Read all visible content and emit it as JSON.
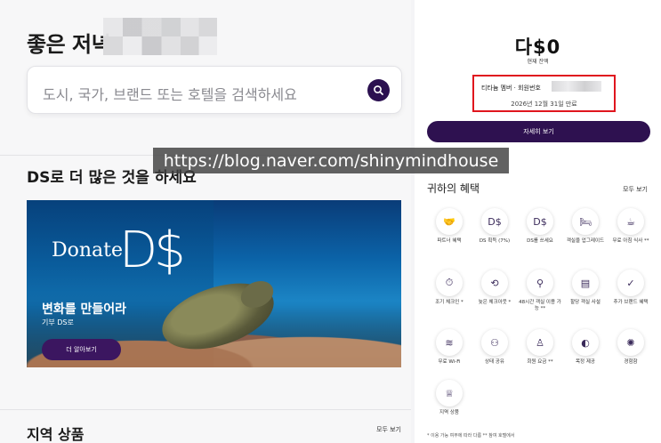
{
  "greeting": "좋은 저녁",
  "search": {
    "placeholder": "도시, 국가, 브랜드 또는 호텔을 검색하세요"
  },
  "section_title": "DS로 더 많은 것을 하세요",
  "banner": {
    "logo_donate": "Donate",
    "logo_ds": "D$",
    "title": "변화를 만들어라",
    "subtitle": "기부 DS로",
    "button": "더 알아보기"
  },
  "region": {
    "title": "지역 상품",
    "all": "모두 보기"
  },
  "account": {
    "brand": "다$0",
    "balance_label": "현재 잔액",
    "member": "티타늄 멤버 · 회원번호",
    "expiry": "2026년 12월 31일 만료",
    "detail_button": "자세히 보기"
  },
  "benefits": {
    "title": "귀하의 혜택",
    "all": "모두 보기",
    "items": [
      {
        "icon": "handshake-icon",
        "glyph": "🤝",
        "label": "파트너 혜택"
      },
      {
        "icon": "ds-earn-icon",
        "glyph": "D$",
        "label": "DS 획득 (7%)"
      },
      {
        "icon": "ds-use-icon",
        "glyph": "D$",
        "label": "DS를 쓰세요"
      },
      {
        "icon": "bed-icon",
        "glyph": "🛏",
        "label": "객실을 업그레이드"
      },
      {
        "icon": "breakfast-icon",
        "glyph": "☕",
        "label": "무료 아침 식사 **"
      },
      {
        "icon": "early-checkin-icon",
        "glyph": "⏱",
        "label": "조기 체크인 *"
      },
      {
        "icon": "late-checkout-icon",
        "glyph": "⟲",
        "label": "늦은 체크아웃 *"
      },
      {
        "icon": "guarantee-icon",
        "glyph": "⚲",
        "label": "48시간 객실 이용 가능 **"
      },
      {
        "icon": "suite-icon",
        "glyph": "▤",
        "label": "할당 객실 사설"
      },
      {
        "icon": "brand-benefit-icon",
        "glyph": "✓",
        "label": "추가 브랜드 혜택"
      },
      {
        "icon": "wifi-icon",
        "glyph": "≋",
        "label": "무료 Wi-Fi"
      },
      {
        "icon": "status-match-icon",
        "glyph": "⚇",
        "label": "상태 공유"
      },
      {
        "icon": "gift-icon",
        "glyph": "♙",
        "label": "회원 요금 **"
      },
      {
        "icon": "water-icon",
        "glyph": "◐",
        "label": "목정 제공"
      },
      {
        "icon": "experience-icon",
        "glyph": "✺",
        "label": "경험함"
      },
      {
        "icon": "crown-icon",
        "glyph": "♕",
        "label": "지역 상품"
      }
    ]
  },
  "footnote": "* 이용 가능 여부에 따라 다름 ** 참여 호텔에서",
  "watermark": "https://blog.naver.com/shinymindhouse"
}
